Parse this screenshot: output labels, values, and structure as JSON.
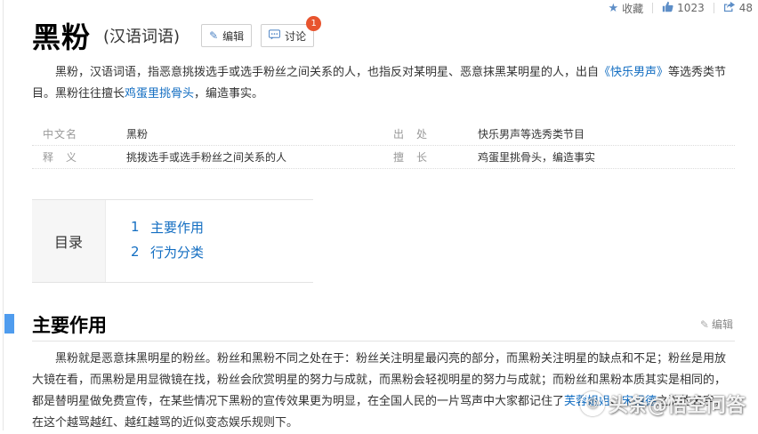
{
  "top_tools": {
    "collect_label": "收藏",
    "like_count": "1023",
    "share_count": "48"
  },
  "entry": {
    "title": "黑粉",
    "subtitle": "(汉语词语)",
    "edit_label": "编辑",
    "discuss_label": "讨论",
    "discuss_badge": "1"
  },
  "summary": {
    "part1": "黑粉，汉语词语，指恶意挑拨选手或选手粉丝之间关系的人，也指反对某明星、恶意抹黑某明星的人，出自",
    "link1": "《快乐男声》",
    "part2": "等选秀类节目。黑粉往往擅长",
    "link2": "鸡蛋里挑骨头",
    "part3": "，编造事实。"
  },
  "infobox": {
    "rows": [
      {
        "k1": "中文名",
        "v1": "黑粉",
        "k2": "出　处",
        "v2": "快乐男声等选秀类节目"
      },
      {
        "k1": "释　义",
        "v1": "挑拨选手或选手粉丝之间关系的人",
        "k2": "擅　长",
        "v2": "鸡蛋里挑骨头，编造事实"
      }
    ]
  },
  "catalog": {
    "title": "目录",
    "items": [
      {
        "num": "1",
        "label": "主要作用"
      },
      {
        "num": "2",
        "label": "行为分类"
      }
    ]
  },
  "section": {
    "title": "主要作用",
    "edit_label": "编辑"
  },
  "paragraph": {
    "text": "黑粉就是恶意抹黑明星的粉丝。粉丝和黑粉不同之处在于：粉丝关注明星最闪亮的部分，而黑粉关注明星的缺点和不足；粉丝是用放大镜在看，而黑粉是用显微镜在找，粉丝会欣赏明星的努力与成就，而黑粉会轻视明星的努力与成就；而粉丝和黑粉本质其实是相同的，都是替明星做免费宣传，在某些情况下黑粉的宣传效果更为明显，在全国人民的一片骂声中大家都记住了",
    "link1": "芙蓉姐姐",
    "sep": "、",
    "link2": "宋祖德",
    "tail": "之流的名字，在这个越骂越红、越红越骂的近似变态娱乐规则下。"
  },
  "watermark": {
    "text": "头条@悟空问答"
  },
  "icons": {
    "collect": "star-icon",
    "like": "thumbs-up-icon",
    "share": "share-icon",
    "edit": "pencil-icon",
    "discuss": "chat-icon"
  },
  "colors": {
    "link": "#136ec2",
    "section_bar": "#4f9cee",
    "badge": "#e8542e"
  }
}
